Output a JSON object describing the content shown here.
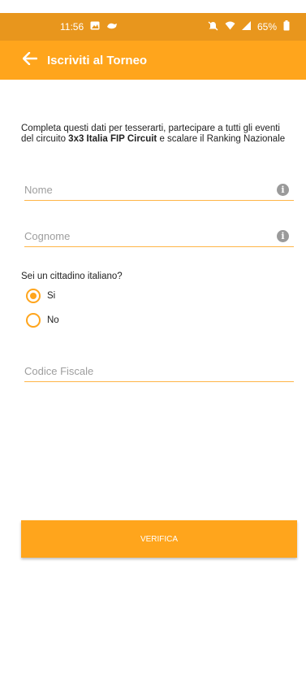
{
  "status_bar": {
    "time": "11:56",
    "battery": "65%"
  },
  "app_bar": {
    "title": "Iscriviti al Torneo"
  },
  "intro": {
    "line1": "Completa questi dati per tesserarti, partecipare a tutti gli eventi",
    "line2_prefix": "del circuito ",
    "line2_bold": "3x3 Italia FIP Circuit",
    "line2_suffix": " e scalare il Ranking Nazionale"
  },
  "form": {
    "nome_placeholder": "Nome",
    "cognome_placeholder": "Cognome",
    "citizen_question": "Sei un cittadino italiano?",
    "options": [
      {
        "label": "Si",
        "selected": true
      },
      {
        "label": "No",
        "selected": false
      }
    ],
    "codice_placeholder": "Codice Fiscale"
  },
  "verify_button": {
    "label": "VERIFICA"
  },
  "colors": {
    "primary": "#ffa51c",
    "status_bar": "#e8961d",
    "underline": "#ffb547"
  }
}
